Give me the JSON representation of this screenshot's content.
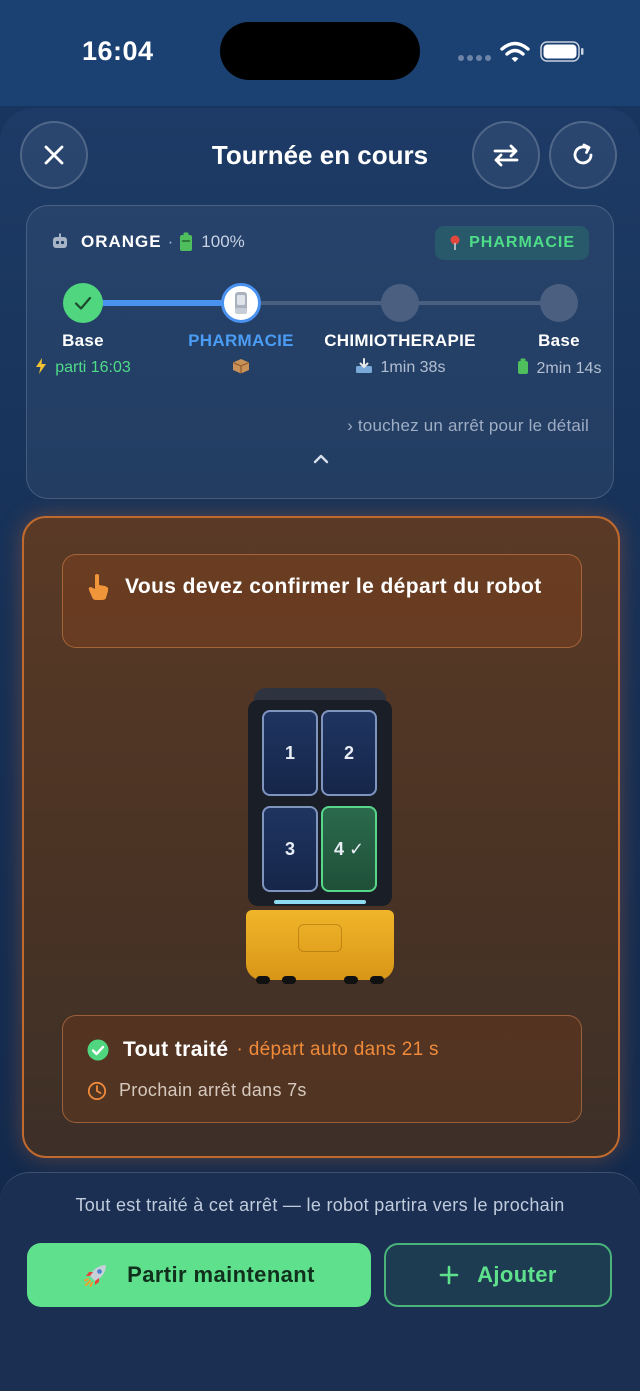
{
  "status_bar": {
    "time": "16:04"
  },
  "header": {
    "title": "Tournée en cours",
    "close_icon": "close-icon",
    "swap_icon": "swap-arrows-icon",
    "refresh_icon": "refresh-icon"
  },
  "route": {
    "robot_name": "ORANGE",
    "separator": "·",
    "battery": "100%",
    "current_badge": "PHARMACIE",
    "stops": [
      {
        "name": "Base",
        "info": "parti 16:03",
        "icon": "lightning-icon",
        "status": "done",
        "name_color": "#ffffff",
        "info_color": "#4fdc88"
      },
      {
        "name": "PHARMACIE",
        "info": "",
        "icon": "package-icon",
        "status": "current",
        "name_color": "#4a9cf5",
        "info_color": "#b3bfd2"
      },
      {
        "name": "CHIMIOTHERAPIE",
        "info": "1min 38s",
        "icon": "inbox-tray-icon",
        "status": "pending",
        "name_color": "#ffffff",
        "info_color": "#b3bfd2"
      },
      {
        "name": "Base",
        "info": "2min 14s",
        "icon": "battery-icon",
        "status": "pending",
        "name_color": "#ffffff",
        "info_color": "#b3bfd2"
      }
    ],
    "hint": "› touchez un arrêt pour le détail"
  },
  "action": {
    "confirm_text": "Vous devez confirmer le départ du robot",
    "drawers": [
      {
        "label": "1",
        "done": false
      },
      {
        "label": "2",
        "done": false
      },
      {
        "label": "3",
        "done": false
      },
      {
        "label": "4 ✓",
        "done": true
      }
    ],
    "done_title": "Tout traité",
    "done_extra": "· départ auto dans 21 s",
    "next_stop": "Prochain arrêt dans 7s"
  },
  "bottom": {
    "info": "Tout est traité à cet arrêt — le robot partira vers le prochain",
    "go_label": "Partir maintenant",
    "add_label": "Ajouter"
  },
  "colors": {
    "accent_green": "#5fe08c",
    "accent_orange": "#ef8a3a",
    "accent_blue": "#4a92f0"
  }
}
